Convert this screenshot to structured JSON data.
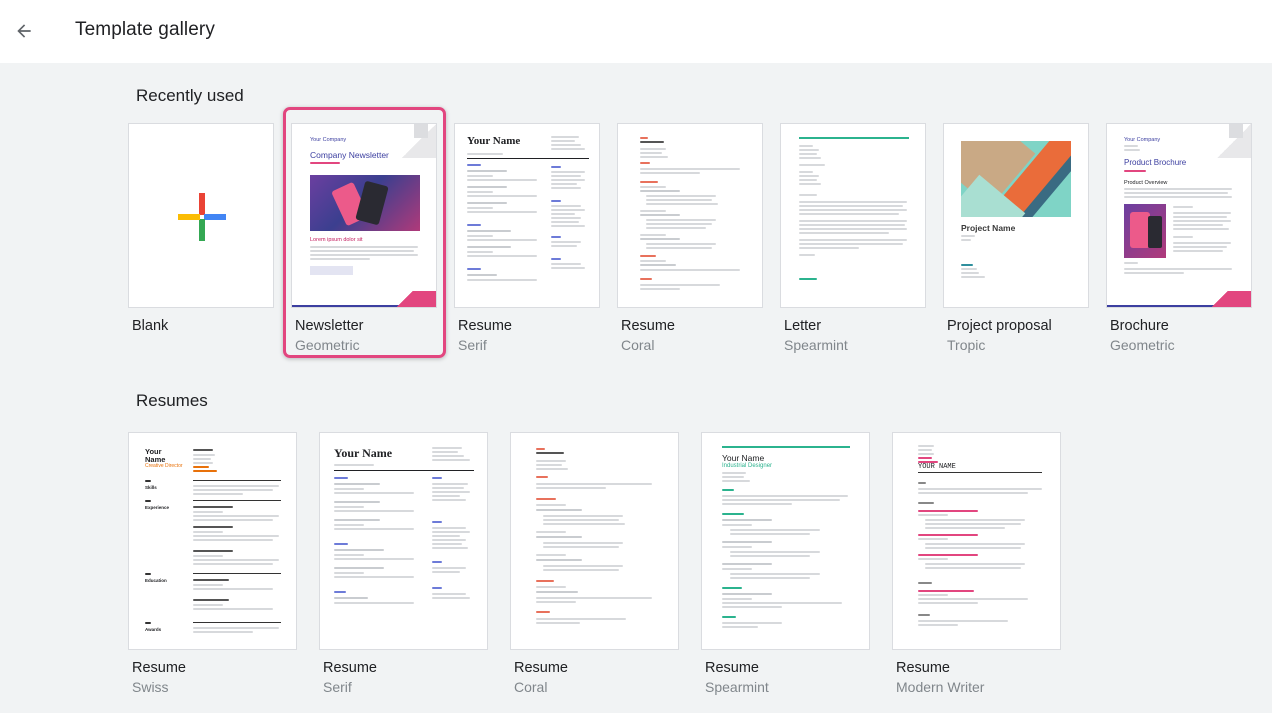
{
  "header": {
    "title": "Template gallery",
    "back_icon": "arrow-back-icon"
  },
  "sections": {
    "recent": {
      "title": "Recently used"
    },
    "resumes": {
      "title": "Resumes"
    }
  },
  "recent": [
    {
      "name": "Blank",
      "sub": ""
    },
    {
      "name": "Newsletter",
      "sub": "Geometric"
    },
    {
      "name": "Resume",
      "sub": "Serif"
    },
    {
      "name": "Resume",
      "sub": "Coral"
    },
    {
      "name": "Letter",
      "sub": "Spearmint"
    },
    {
      "name": "Project proposal",
      "sub": "Tropic"
    },
    {
      "name": "Brochure",
      "sub": "Geometric"
    }
  ],
  "resumes": [
    {
      "name": "Resume",
      "sub": "Swiss"
    },
    {
      "name": "Resume",
      "sub": "Serif"
    },
    {
      "name": "Resume",
      "sub": "Coral"
    },
    {
      "name": "Resume",
      "sub": "Spearmint"
    },
    {
      "name": "Resume",
      "sub": "Modern Writer"
    }
  ],
  "thumbs": {
    "newsletter": {
      "company": "Your Company",
      "title": "Company Newsletter",
      "headline": "Lorem ipsum dolor sit"
    },
    "serif": {
      "name": "Your Name"
    },
    "coral": {
      "name": "Hello\nI'm Your Name"
    },
    "proposal": {
      "title": "Project Name"
    },
    "brochure": {
      "company": "Your Company",
      "title": "Product Brochure",
      "overview": "Product Overview"
    },
    "swiss": {
      "name1": "Your",
      "name2": "Name",
      "role": "Creative Director",
      "skills": "Skills",
      "experience": "Experience",
      "education": "Education",
      "awards": "Awards"
    },
    "serif2": {
      "name": "Your Name"
    },
    "spearmint": {
      "name": "Your Name",
      "role": "Industrial Designer"
    },
    "writer": {
      "name": "YOUR NAME"
    }
  },
  "colors": {
    "accent_pink": "#e2467f",
    "brand_blue": "#4285f4",
    "brand_red": "#ea4335",
    "brand_yellow": "#fbbc04",
    "brand_green": "#34a853"
  }
}
